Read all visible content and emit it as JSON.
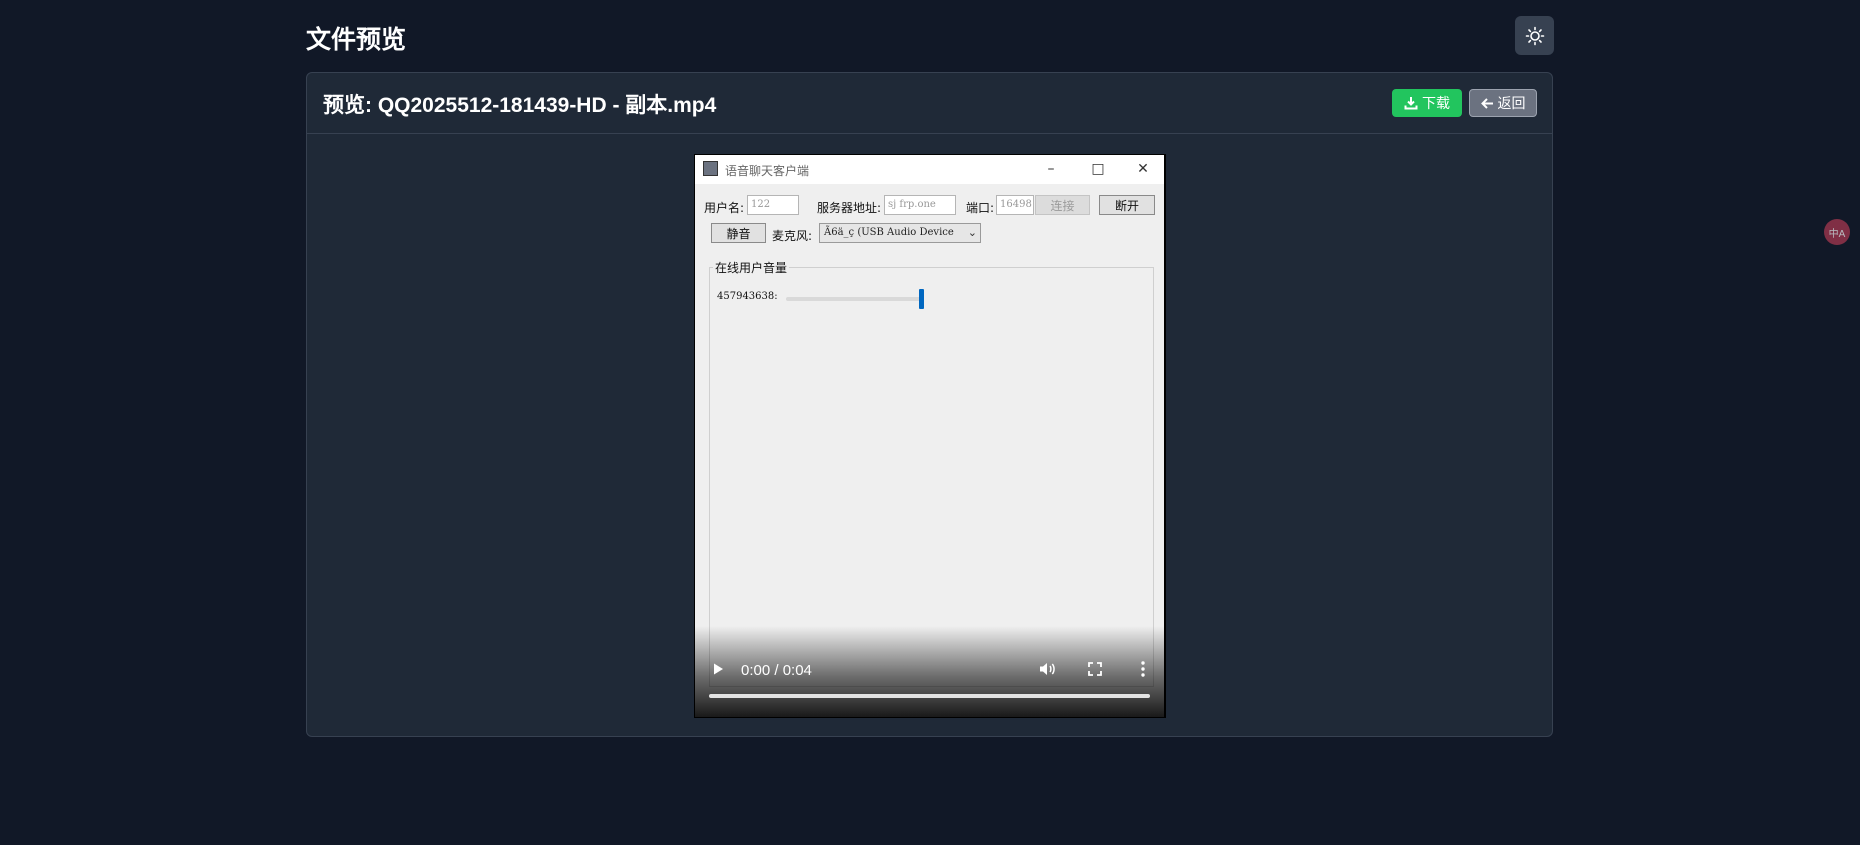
{
  "page": {
    "title": "文件预览",
    "theme_toggle_icon": "sun-icon"
  },
  "card": {
    "title": "预览: QQ2025512-181439-HD - 副本.mp4",
    "download_label": "下载",
    "download_icon": "download-icon",
    "back_label": "返回",
    "back_icon": "arrow-left-icon"
  },
  "video": {
    "time_display": "0:00 / 0:04",
    "progress": 0,
    "controls": [
      "play-icon",
      "volume-icon",
      "fullscreen-icon",
      "more-options-icon"
    ],
    "frame": {
      "window_title": "语音聊天客户端",
      "username_label": "用户名:",
      "username_value": "122",
      "server_label": "服务器地址:",
      "server_value": "sj frp.one",
      "port_label": "端口:",
      "port_value": "16498",
      "connect_label": "连接",
      "disconnect_label": "断开",
      "mute_label": "静音",
      "mic_label": "麦克风:",
      "mic_value": "Ã6ä_ç (USB Audio Device",
      "group_title": "在线用户音量",
      "users": [
        {
          "id": "457943638:",
          "volume": 1.0
        }
      ]
    }
  },
  "extension": {
    "label": "中A"
  },
  "colors": {
    "background": "#111827",
    "card": "#1f2937",
    "download": "#22c55e",
    "back": "#6b7280",
    "slider_thumb": "#0067c0"
  }
}
